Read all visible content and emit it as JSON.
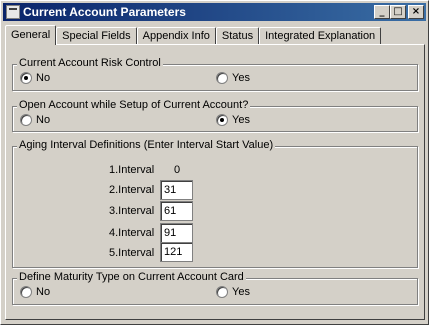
{
  "window": {
    "title": "Current Account Parameters"
  },
  "title_buttons": {
    "minimize": "_",
    "maximize": "□",
    "close": "×"
  },
  "tabs": [
    {
      "label": "General"
    },
    {
      "label": "Special Fields"
    },
    {
      "label": "Appendix Info"
    },
    {
      "label": "Status"
    },
    {
      "label": "Integrated Explanation"
    }
  ],
  "risk_control": {
    "title": "Current Account Risk Control",
    "no_label": "No",
    "yes_label": "Yes",
    "selected": "No"
  },
  "open_account": {
    "title": "Open Account while Setup of Current Account?",
    "no_label": "No",
    "yes_label": "Yes",
    "selected": "Yes"
  },
  "aging": {
    "title": "Aging Interval Definitions (Enter Interval Start Value)",
    "intervals": [
      {
        "label": "1.Interval",
        "value": "0"
      },
      {
        "label": "2.Interval",
        "value": "31"
      },
      {
        "label": "3.Interval",
        "value": "61"
      },
      {
        "label": "4.Interval",
        "value": "91"
      },
      {
        "label": "5.Interval",
        "value": "121"
      }
    ]
  },
  "maturity": {
    "title": "Define Maturity Type on Current Account Card",
    "no_label": "No",
    "yes_label": "Yes",
    "selected": "none"
  }
}
